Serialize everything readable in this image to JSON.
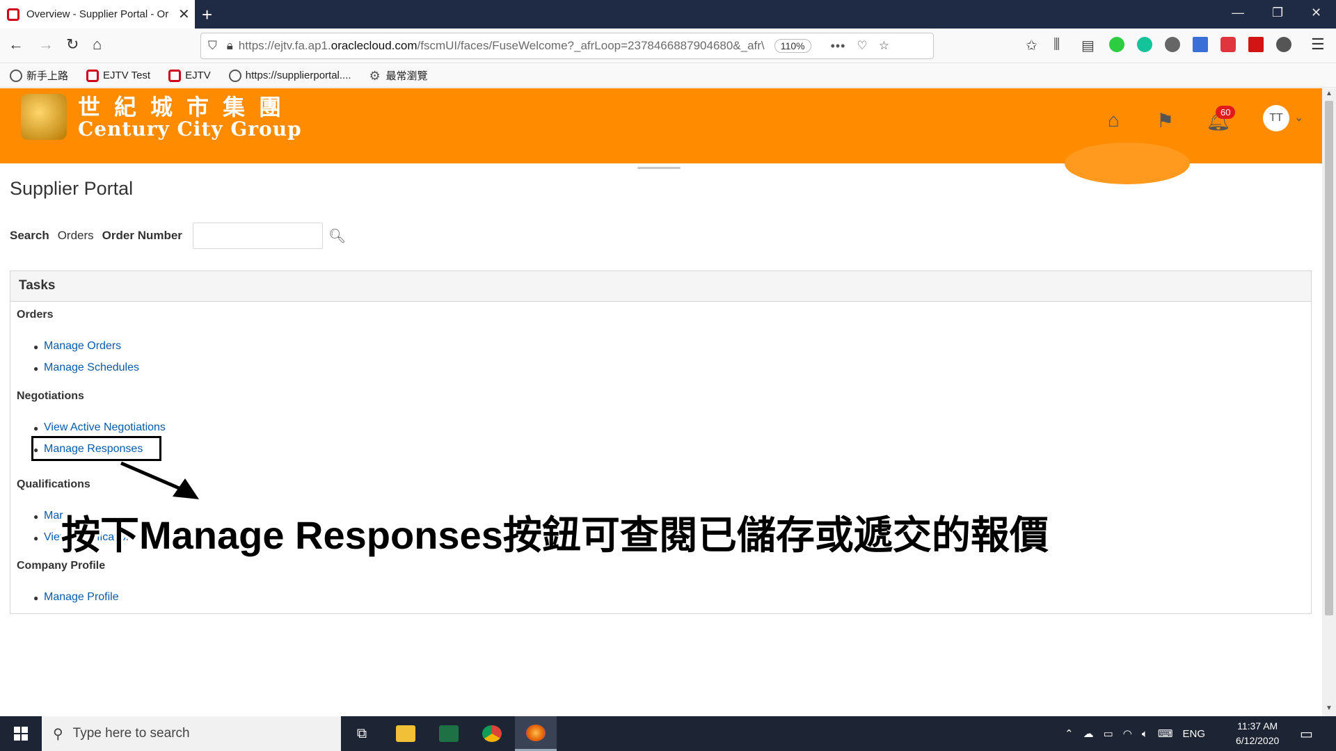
{
  "browser": {
    "tab_title": "Overview - Supplier Portal - Or",
    "url_prefix": "https://ejtv.fa.ap1.",
    "url_domain": "oraclecloud.com",
    "url_rest": "/fscmUI/faces/FuseWelcome?_afrLoop=2378466887904680&_afr\\",
    "zoom": "110%",
    "bookmarks": [
      "新手上路",
      "EJTV Test",
      "EJTV",
      "https://supplierportal....",
      "最常瀏覽"
    ]
  },
  "header": {
    "brand_cn": "世紀城市集團",
    "brand_en": "Century City Group",
    "notification_count": "60",
    "avatar_initials": "TT",
    "accent_color": "#ff8c00"
  },
  "page": {
    "title": "Supplier Portal",
    "search": {
      "label": "Search",
      "category": "Orders",
      "field_label": "Order Number",
      "value": ""
    },
    "tasks": {
      "title": "Tasks",
      "orders_title": "Orders",
      "orders": [
        "Manage Orders",
        "Manage Schedules"
      ],
      "negotiations_title": "Negotiations",
      "negotiations": [
        "View Active Negotiations",
        "Manage Responses"
      ],
      "qualifications_title": "Qualifications",
      "qualifications": [
        "Mar",
        "View Qualifications"
      ],
      "profile_title": "Company Profile",
      "profile": [
        "Manage Profile"
      ]
    }
  },
  "overlay": {
    "caption": "按下Manage Responses按鈕可查閱已儲存或遞交的報價"
  },
  "taskbar": {
    "search_placeholder": "Type here to search",
    "lang": "ENG",
    "time": "11:37 AM",
    "date": "6/12/2020"
  }
}
